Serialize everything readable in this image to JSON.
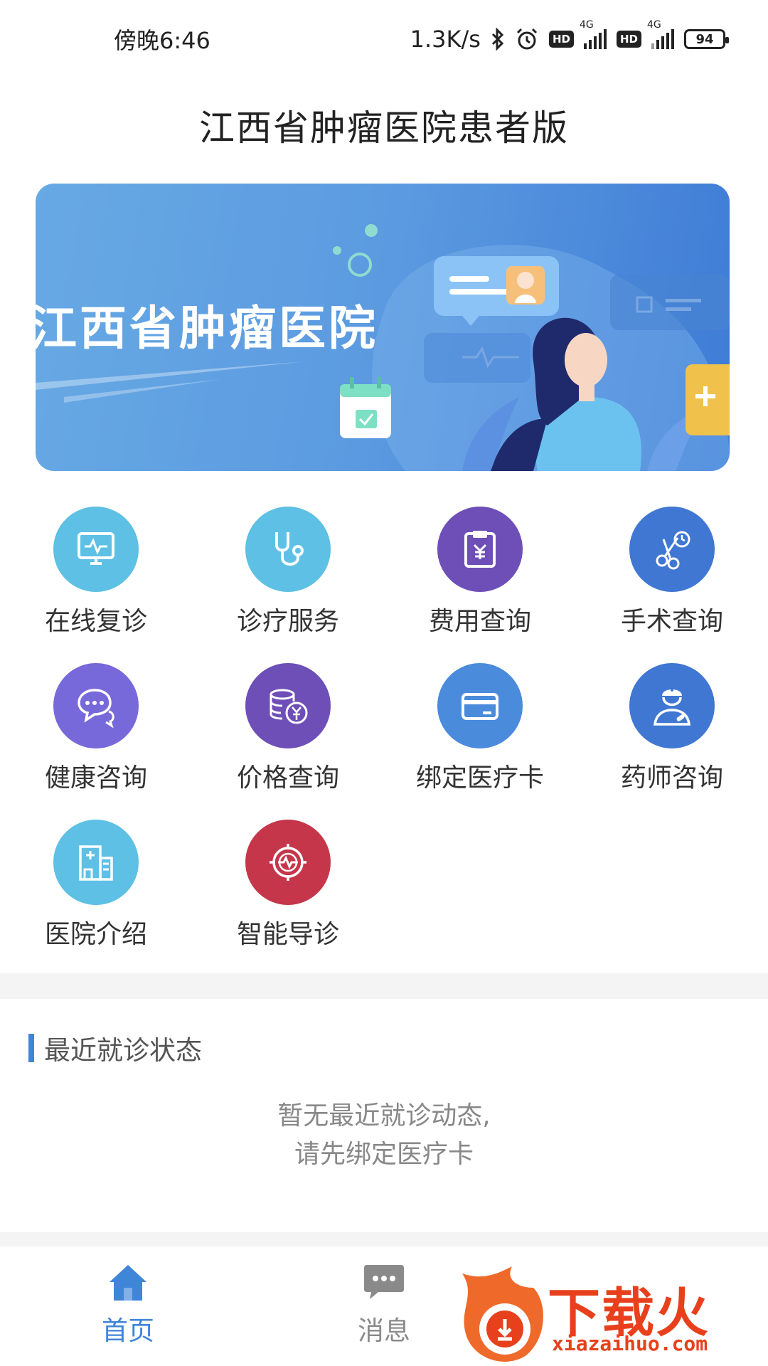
{
  "status_bar": {
    "time": "傍晚6:46",
    "net_speed": "1.3K/s",
    "battery": "94",
    "hd1": "HD",
    "hd2": "HD",
    "sig1_tag": "4G",
    "sig2_tag": "4G"
  },
  "header": {
    "title": "江西省肿瘤医院患者版"
  },
  "banner": {
    "title": "江西省肿瘤医院"
  },
  "grid": {
    "items": [
      {
        "label": "在线复诊",
        "icon": "monitor-pulse-icon",
        "color": "#5ec0e4"
      },
      {
        "label": "诊疗服务",
        "icon": "stethoscope-icon",
        "color": "#5ec0e4"
      },
      {
        "label": "费用查询",
        "icon": "clipboard-yen-icon",
        "color": "#6e4fb7"
      },
      {
        "label": "手术查询",
        "icon": "scissors-clock-icon",
        "color": "#3f77d2"
      },
      {
        "label": "健康咨询",
        "icon": "chat-bubbles-icon",
        "color": "#7769d9"
      },
      {
        "label": "价格查询",
        "icon": "coins-yen-icon",
        "color": "#6e4fb7"
      },
      {
        "label": "绑定医疗卡",
        "icon": "card-icon",
        "color": "#4a8bdc"
      },
      {
        "label": "药师咨询",
        "icon": "doctor-icon",
        "color": "#3f77d2"
      },
      {
        "label": "医院介绍",
        "icon": "hospital-building-icon",
        "color": "#5ec0e4"
      },
      {
        "label": "智能导诊",
        "icon": "target-pulse-icon",
        "color": "#c6364a"
      }
    ]
  },
  "recent": {
    "title": "最近就诊状态",
    "empty_line1": "暂无最近就诊动态,",
    "empty_line2": "请先绑定医疗卡"
  },
  "nav": {
    "home_label": "首页",
    "msg_label": "消息"
  },
  "watermark": {
    "text": "下载火",
    "url": "xiazaihuo.com"
  }
}
